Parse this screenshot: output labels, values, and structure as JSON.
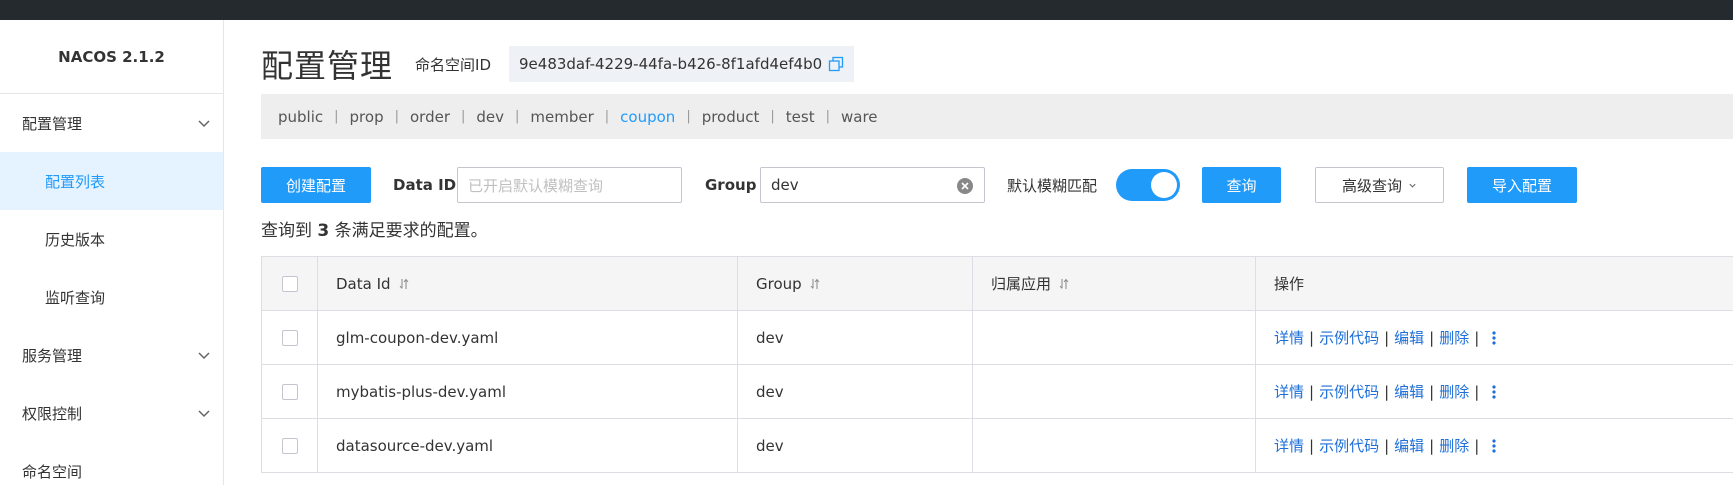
{
  "app": {
    "brand": "NACOS 2.1.2"
  },
  "sidebar": {
    "groups": [
      {
        "label": "配置管理",
        "children": [
          "配置列表",
          "历史版本",
          "监听查询"
        ]
      },
      {
        "label": "服务管理"
      },
      {
        "label": "权限控制"
      },
      {
        "label": "命名空间"
      }
    ]
  },
  "header": {
    "title": "配置管理",
    "namespace_label": "命名空间ID",
    "namespace_id": "9e483daf-4229-44fa-b426-8f1afd4ef4b0"
  },
  "namespaces": [
    "public",
    "prop",
    "order",
    "dev",
    "member",
    "coupon",
    "product",
    "test",
    "ware"
  ],
  "namespace_active": "coupon",
  "toolbar": {
    "create_label": "创建配置",
    "dataid_label": "Data ID",
    "dataid_placeholder": "已开启默认模糊查询",
    "group_label": "Group",
    "group_value": "dev",
    "fuzzy_label": "默认模糊匹配",
    "fuzzy_on": true,
    "query_label": "查询",
    "advanced_label": "高级查询",
    "import_label": "导入配置"
  },
  "result": {
    "prefix": "查询到 ",
    "count": "3",
    "suffix": " 条满足要求的配置。"
  },
  "table": {
    "headers": [
      "Data Id",
      "Group",
      "归属应用",
      "操作"
    ],
    "rows": [
      {
        "data_id": "glm-coupon-dev.yaml",
        "group": "dev",
        "app": ""
      },
      {
        "data_id": "mybatis-plus-dev.yaml",
        "group": "dev",
        "app": ""
      },
      {
        "data_id": "datasource-dev.yaml",
        "group": "dev",
        "app": ""
      }
    ],
    "actions": [
      "详情",
      "示例代码",
      "编辑",
      "删除"
    ]
  },
  "colors": {
    "primary": "#209bfa",
    "link": "#1e6fd9",
    "topbar": "#252a2f",
    "active_bg": "#e5f2ff"
  }
}
